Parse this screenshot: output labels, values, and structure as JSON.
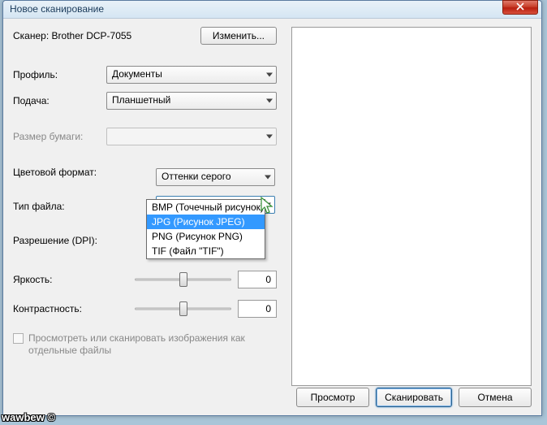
{
  "title": "Новое сканирование",
  "scanner": {
    "label": "Сканер:",
    "name": "Brother DCP-7055",
    "change_btn": "Изменить..."
  },
  "profile": {
    "label": "Профиль:",
    "value": "Документы"
  },
  "feed": {
    "label": "Подача:",
    "value": "Планшетный"
  },
  "paper_size": {
    "label": "Размер бумаги:",
    "value": ""
  },
  "color_format": {
    "label": "Цветовой формат:",
    "value": "Оттенки серого"
  },
  "file_type": {
    "label": "Тип файла:",
    "value": "JPG (Рисунок JPEG)",
    "options": [
      "BMP (Точечный рисунок)",
      "JPG (Рисунок JPEG)",
      "PNG (Рисунок PNG)",
      "TIF (Файл \"TIF\")"
    ],
    "selected_index": 1
  },
  "resolution": {
    "label": "Разрешение (DPI):",
    "value": ""
  },
  "brightness": {
    "label": "Яркость:",
    "value": "0",
    "percent": 50
  },
  "contrast": {
    "label": "Контрастность:",
    "value": "0",
    "percent": 50
  },
  "separate_files": {
    "label": "Просмотреть или сканировать изображения как отдельные файлы",
    "checked": false
  },
  "footer": {
    "preview": "Просмотр",
    "scan": "Сканировать",
    "cancel": "Отмена"
  },
  "watermark": "wawbew ©"
}
